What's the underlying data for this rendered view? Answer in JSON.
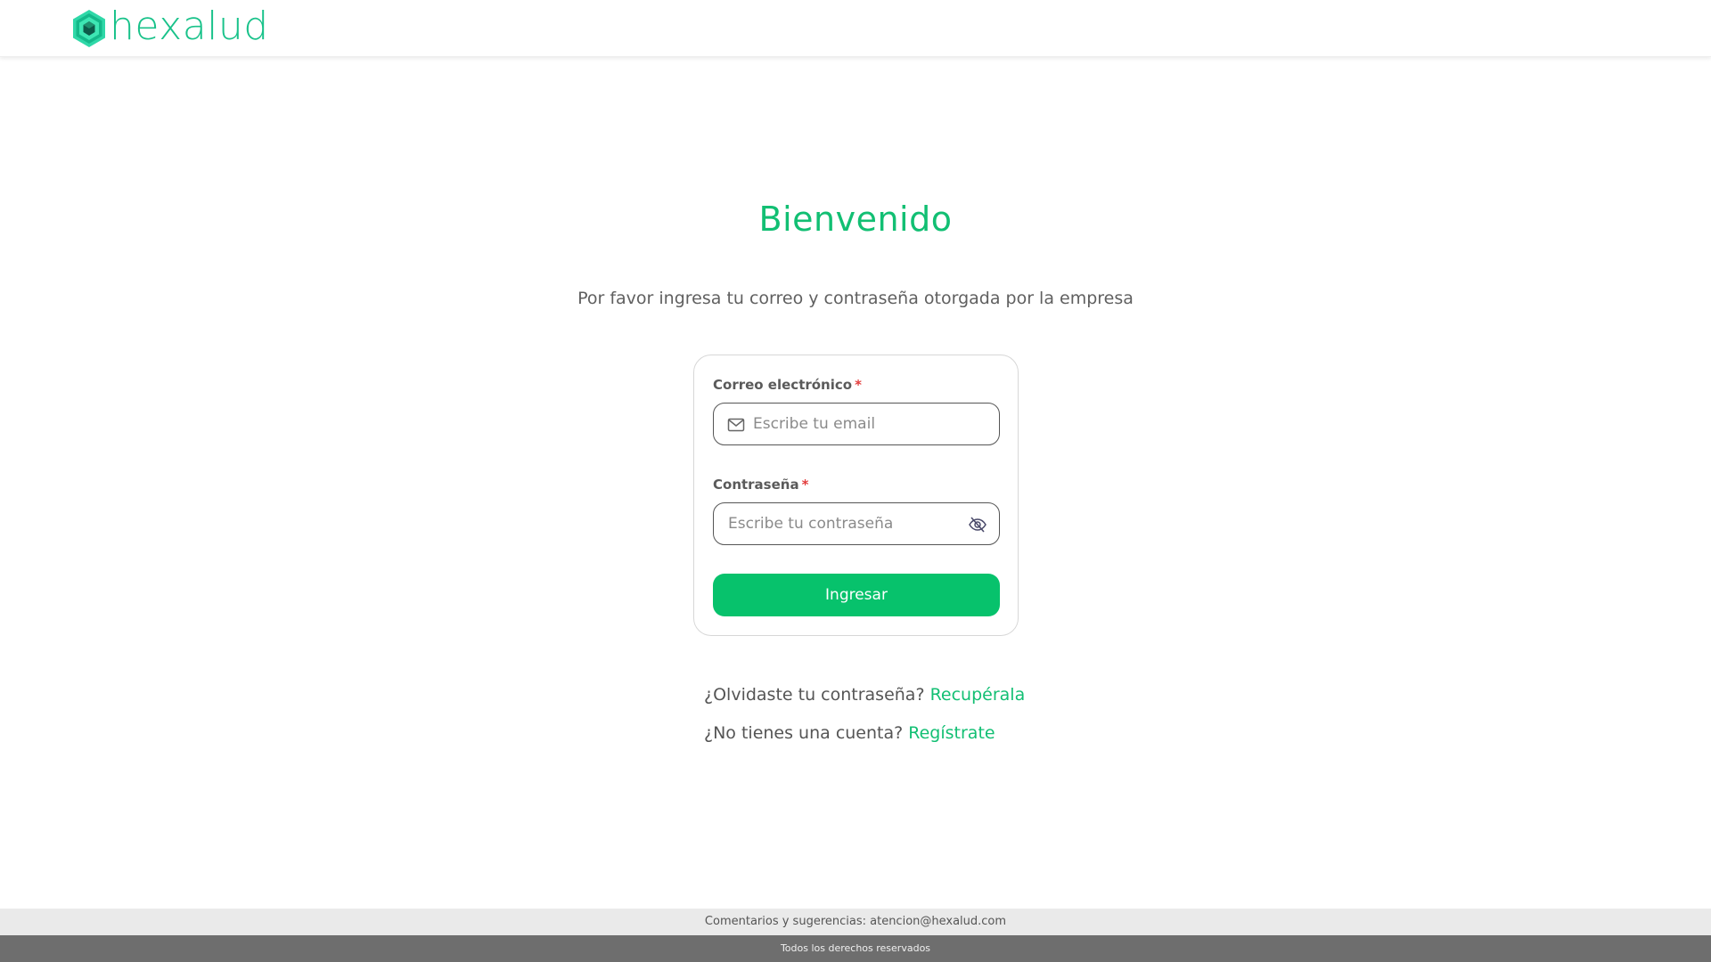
{
  "header": {
    "brand_name": "hexalud",
    "logo_icon": "hexagon-logo-icon",
    "brand_color": "#19c28a"
  },
  "main": {
    "title": "Bienvenido",
    "subtitle": "Por favor ingresa tu correo y contraseña otorgada por la empresa"
  },
  "form": {
    "email": {
      "label": "Correo electrónico",
      "required_mark": "*",
      "placeholder": "Escribe tu email",
      "value": "",
      "icon": "envelope-icon"
    },
    "password": {
      "label": "Contraseña",
      "required_mark": "*",
      "placeholder": "Escribe tu contraseña",
      "value": "",
      "icon": "eye-off-icon"
    },
    "submit_label": "Ingresar",
    "accent_color": "#07c26c"
  },
  "links": {
    "forgot_prompt": "¿Olvidaste tu contraseña?",
    "forgot_link": "Recupérala",
    "register_prompt": "¿No tienes una cuenta?",
    "register_link": "Regístrate"
  },
  "footer": {
    "feedback_text": "Comentarios y sugerencias: atencion@hexalud.com",
    "rights_text": "Todos los derechos reservados"
  }
}
